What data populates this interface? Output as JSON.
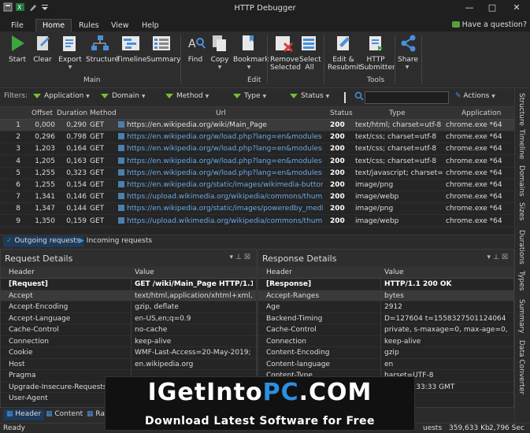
{
  "window": {
    "title": "HTTP Debugger"
  },
  "menu": {
    "file": "File",
    "home": "Home",
    "rules": "Rules",
    "view": "View",
    "help": "Help",
    "question": "Have a question?"
  },
  "ribbon": {
    "start": "Start",
    "clear": "Clear",
    "export": "Export",
    "structure": "Structure",
    "timeline": "Timeline",
    "summary": "Summary",
    "group_main": "Main",
    "find": "Find",
    "copy": "Copy",
    "bookmark": "Bookmark",
    "group_edit": "Edit",
    "remove_selected_1": "Remove",
    "remove_selected_2": "Selected",
    "select_all_1": "Select",
    "select_all_2": "All",
    "edit_resubmit_1": "Edit &",
    "edit_resubmit_2": "Resubmit",
    "http_submitter_1": "HTTP",
    "http_submitter_2": "Submitter",
    "group_tools": "Tools",
    "share": "Share"
  },
  "filters": {
    "label": "Filters:",
    "application": "Application",
    "domain": "Domain",
    "method": "Method",
    "type": "Type",
    "status": "Status",
    "search_value": "",
    "actions": "Actions"
  },
  "grid": {
    "columns": [
      "",
      "Offset",
      "Duration",
      "Method",
      "Url",
      "Status",
      "Type",
      "Application"
    ],
    "rows": [
      [
        "1",
        "0,000",
        "0,290",
        "GET",
        "https://en.wikipedia.org/wiki/Main_Page",
        "200",
        "text/html; charset=utf-8",
        "chrome.exe *64"
      ],
      [
        "2",
        "0,296",
        "0,798",
        "GET",
        "https://en.wikipedia.org/w/load.php?lang=en&modules=ext.3...",
        "200",
        "text/css; charset=utf-8",
        "chrome.exe *64"
      ],
      [
        "3",
        "1,203",
        "0,164",
        "GET",
        "https://en.wikipedia.org/w/load.php?lang=en&modules=ext.g...",
        "200",
        "text/css; charset=utf-8",
        "chrome.exe *64"
      ],
      [
        "4",
        "1,205",
        "0,163",
        "GET",
        "https://en.wikipedia.org/w/load.php?lang=en&modules=site.s...",
        "200",
        "text/css; charset=utf-8",
        "chrome.exe *64"
      ],
      [
        "5",
        "1,255",
        "0,323",
        "GET",
        "https://en.wikipedia.org/w/load.php?lang=en&modules=start...",
        "200",
        "text/javascript; charset=utf-8",
        "chrome.exe *64"
      ],
      [
        "6",
        "1,255",
        "0,154",
        "GET",
        "https://en.wikipedia.org/static/images/wikimedia-button-1.5x...",
        "200",
        "image/png",
        "chrome.exe *64"
      ],
      [
        "7",
        "1,341",
        "0,146",
        "GET",
        "https://upload.wikimedia.org/wikipedia/commons/thumb/b/b...",
        "200",
        "image/webp",
        "chrome.exe *64"
      ],
      [
        "8",
        "1,347",
        "0,144",
        "GET",
        "https://en.wikipedia.org/static/images/poweredby_mediawiki_...",
        "200",
        "image/png",
        "chrome.exe *64"
      ],
      [
        "9",
        "1,350",
        "0,159",
        "GET",
        "https://upload.wikimedia.org/wikipedia/commons/thumb/7/7...",
        "200",
        "image/webp",
        "chrome.exe *64"
      ]
    ],
    "tab_outgoing": "Outgoing requests",
    "tab_incoming": "Incoming requests"
  },
  "side_tabs": [
    "Structure",
    "Timeline",
    "Domains",
    "Sizes",
    "Durations",
    "Types",
    "Summary",
    "Data Converter"
  ],
  "request": {
    "title": "Request Details",
    "col_header": "Header",
    "col_value": "Value",
    "rows": [
      [
        "[Request]",
        "GET /wiki/Main_Page HTTP/1.1"
      ],
      [
        "Accept",
        "text/html,application/xhtml+xml,appli..."
      ],
      [
        "Accept-Encoding",
        "gzip, deflate"
      ],
      [
        "Accept-Language",
        "en-US,en;q=0.9"
      ],
      [
        "Cache-Control",
        "no-cache"
      ],
      [
        "Connection",
        "keep-alive"
      ],
      [
        "Cookie",
        "WMF-Last-Access=20-May-2019; WM..."
      ],
      [
        "Host",
        "en.wikipedia.org"
      ],
      [
        "Pragma",
        ""
      ],
      [
        "Upgrade-Insecure-Requests",
        ""
      ],
      [
        "User-Agent",
        ""
      ]
    ],
    "tab_header": "Header",
    "tab_content": "Content",
    "tab_raw": "Raw"
  },
  "response": {
    "title": "Response Details",
    "col_header": "Header",
    "col_value": "Value",
    "rows": [
      [
        "[Response]",
        "HTTP/1.1 200 OK"
      ],
      [
        "Accept-Ranges",
        "bytes"
      ],
      [
        "Age",
        "2912"
      ],
      [
        "Backend-Timing",
        "D=127604 t=1558327501124064"
      ],
      [
        "Cache-Control",
        "private, s-maxage=0, max-age=0, m..."
      ],
      [
        "Connection",
        "keep-alive"
      ],
      [
        "Content-Encoding",
        "gzip"
      ],
      [
        "Content-language",
        "en"
      ],
      [
        "Content-Type",
        "harset=UTF-8"
      ],
      [
        "Date",
        "2019 05:33:33 GMT"
      ]
    ]
  },
  "status": {
    "ready": "Ready",
    "requests": "uests",
    "size": "359,633 Kb",
    "time": "2,796 Sec"
  },
  "watermark": {
    "logo_a": "IGetInto",
    "logo_b": "PC",
    "logo_c": ".COM",
    "tagline": "Download Latest Software for Free"
  }
}
